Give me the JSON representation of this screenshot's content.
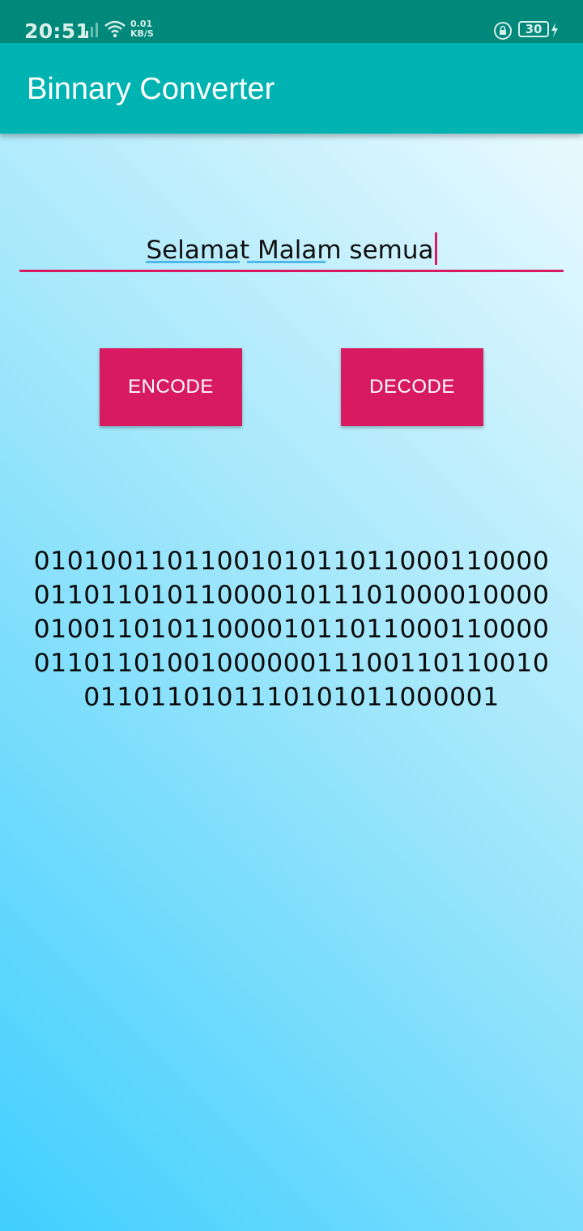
{
  "status_bar": {
    "time": "20:51",
    "net_speed_value": "0.01",
    "net_speed_unit": "KB/S",
    "battery_level": "30",
    "icons": [
      "signal-icon",
      "wifi-icon",
      "rotation-lock-icon",
      "battery-icon",
      "charging-bolt-icon"
    ]
  },
  "app_bar": {
    "title": "Binnary Converter",
    "color": "#00b3b3"
  },
  "input": {
    "value": "Selamat Malam semua",
    "underline_color": "#d81b60"
  },
  "buttons": {
    "encode_label": "ENCODE",
    "decode_label": "DECODE",
    "color": "#d81b60"
  },
  "output": {
    "lines": [
      "0101001101100101011011000110000",
      "0110110101100001011101000010000",
      "0100110101100001011011000110000",
      "0110110100100000011100110110010",
      "0110110101110101011000001"
    ]
  },
  "colors": {
    "status_bar": "#00897b",
    "background_start": "#40cfff",
    "background_end": "#f6fdff"
  }
}
